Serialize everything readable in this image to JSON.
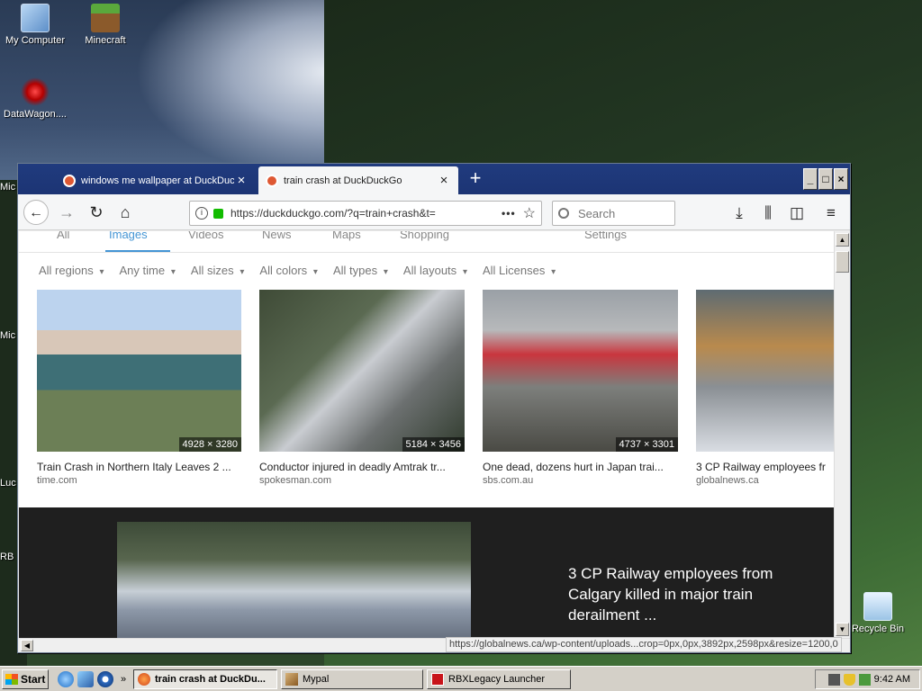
{
  "desktop": {
    "icons": [
      {
        "label": "My Computer"
      },
      {
        "label": "Minecraft"
      },
      {
        "label": "DataWagon...."
      },
      {
        "label": "Recycle Bin"
      }
    ],
    "edge_labels": [
      "Mic",
      "Mic",
      "Luc",
      "RB"
    ]
  },
  "browser": {
    "tabs": [
      {
        "title": "windows me wallpaper at DuckDuckGo"
      },
      {
        "title": "train crash at DuckDuckGo"
      }
    ],
    "new_tab": "+",
    "window_buttons": {
      "minimize": "_",
      "maximize": "□",
      "close": "×"
    },
    "address": "https://duckduckgo.com/?q=train+crash&t=",
    "search_placeholder": "Search",
    "ddg_nav": {
      "all": "All",
      "images": "Images",
      "videos": "Videos",
      "news": "News",
      "maps": "Maps",
      "shopping": "Shopping",
      "settings": "Settings"
    },
    "filters": [
      "All regions",
      "Any time",
      "All sizes",
      "All colors",
      "All types",
      "All layouts",
      "All Licenses"
    ],
    "results": [
      {
        "dims": "4928 × 3280",
        "caption": "Train Crash in Northern Italy Leaves 2 ...",
        "source": "time.com"
      },
      {
        "dims": "5184 × 3456",
        "caption": "Conductor injured in deadly Amtrak tr...",
        "source": "spokesman.com"
      },
      {
        "dims": "4737 × 3301",
        "caption": "One dead, dozens hurt in Japan trai...",
        "source": "sbs.com.au"
      },
      {
        "dims": "",
        "caption": "3 CP Railway employees fr",
        "source": "globalnews.ca"
      }
    ],
    "detail_title": "3 CP Railway employees from Calgary killed in major train derailment ...",
    "status_url": "https://globalnews.ca/wp-content/uploads...crop=0px,0px,3892px,2598px&resize=1200,0"
  },
  "taskbar": {
    "start": "Start",
    "tasks": [
      {
        "label": "train crash at DuckDu..."
      },
      {
        "label": "Mypal"
      },
      {
        "label": "RBXLegacy Launcher"
      }
    ],
    "clock": "9:42 AM"
  },
  "colors": {
    "accent": "#4495d4",
    "tabbar": "#1f3a7c",
    "ddg": "#de5833"
  }
}
